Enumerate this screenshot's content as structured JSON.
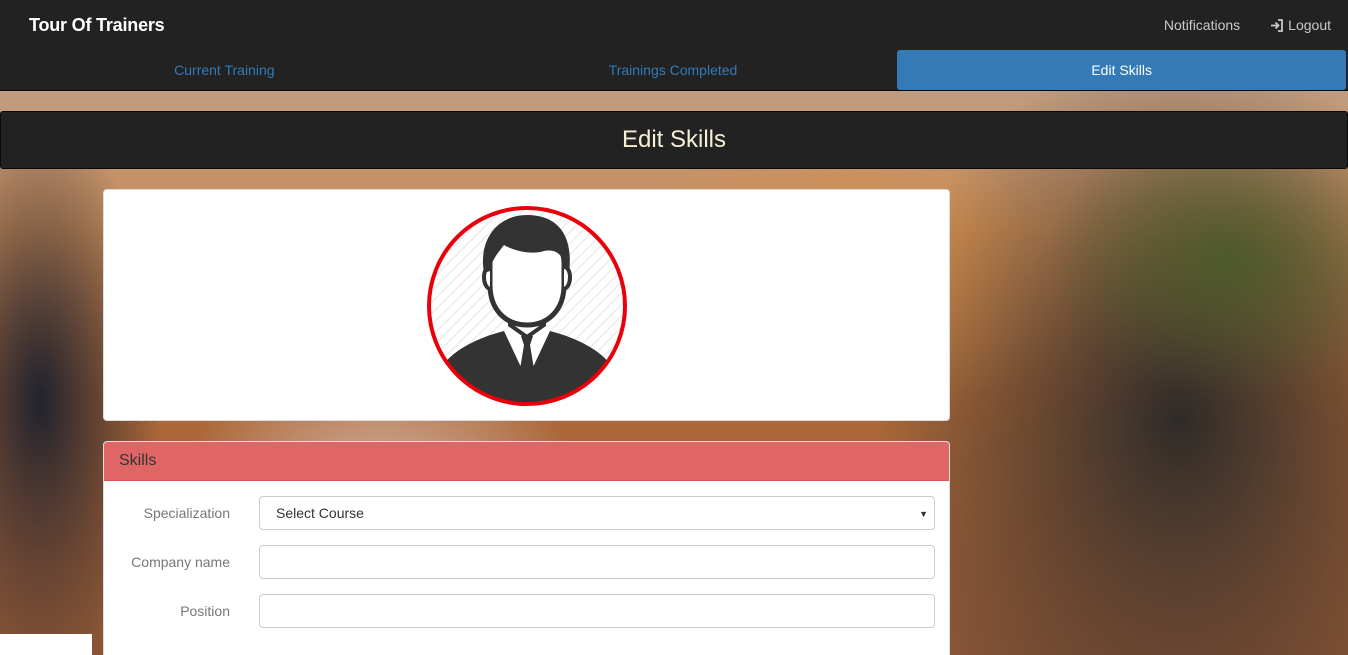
{
  "app": {
    "brand": "Tour Of Trainers"
  },
  "nav_right": {
    "notifications": "Notifications",
    "logout": "Logout"
  },
  "tabs": [
    {
      "label": "Current Training",
      "active": false
    },
    {
      "label": "Trainings Completed",
      "active": false
    },
    {
      "label": "Edit Skills",
      "active": true
    }
  ],
  "page": {
    "title": "Edit Skills"
  },
  "skills": {
    "heading": "Skills",
    "specialization_label": "Specialization",
    "specialization_value": "Select Course",
    "company_label": "Company name",
    "company_value": "",
    "position_label": "Position",
    "position_value": ""
  },
  "colors": {
    "nav_bg": "#222222",
    "accent_blue": "#337ab7",
    "skills_heading": "#e06666",
    "avatar_ring": "#e8000b"
  }
}
